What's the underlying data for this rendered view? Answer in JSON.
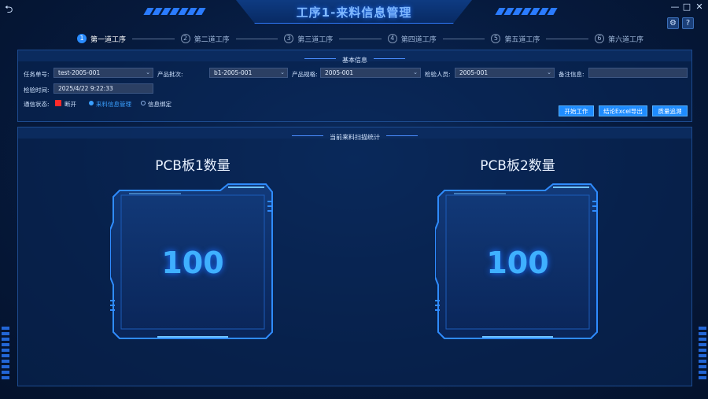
{
  "app": {
    "title": "工序1-来料信息管理",
    "back_icon": "back-arrow-icon",
    "minimize": "—",
    "maximize": "□",
    "close": "✕",
    "settings_icon": "gear-icon",
    "help_label": "?"
  },
  "steps": [
    {
      "num": "1",
      "label": "第一道工序",
      "active": true
    },
    {
      "num": "2",
      "label": "第二道工序",
      "active": false
    },
    {
      "num": "3",
      "label": "第三道工序",
      "active": false
    },
    {
      "num": "4",
      "label": "第四道工序",
      "active": false
    },
    {
      "num": "5",
      "label": "第五道工序",
      "active": false
    },
    {
      "num": "6",
      "label": "第六道工序",
      "active": false
    }
  ],
  "basic_info": {
    "header": "基本信息",
    "task_no_label": "任务单号:",
    "task_no_value": "test-2005-001",
    "batch_label": "产品批次:",
    "batch_value": "b1-2005-001",
    "spec_label": "产品规格:",
    "spec_value": "2005-001",
    "inspector_label": "检验人员:",
    "inspector_value": "2005-001",
    "remark_label": "备注信息:",
    "remark_value": "",
    "time_label": "检验时间:",
    "time_value": "2025/4/22  9:22:33",
    "comm_label": "通信状态:",
    "comm_status": "断开",
    "comm_status_color": "#ff2a2a",
    "radio_1": "来料信息管理",
    "radio_2": "信息绑定",
    "btn_start": "开始工作",
    "btn_export": "结论Excel导出",
    "btn_trace": "质量追溯"
  },
  "stats": {
    "header": "当前来料扫描统计",
    "cards": [
      {
        "title": "PCB板1数量",
        "value": "100"
      },
      {
        "title": "PCB板2数量",
        "value": "100"
      }
    ]
  },
  "colors": {
    "accent": "#1e8cff",
    "background": "#061a3d",
    "value": "#3fb0ff"
  }
}
